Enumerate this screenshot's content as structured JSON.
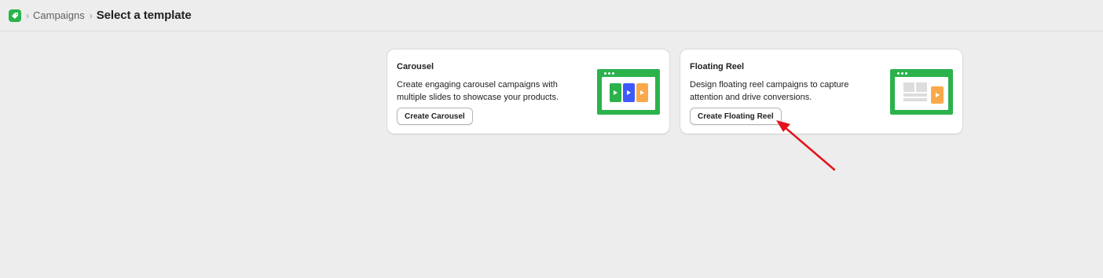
{
  "breadcrumb": {
    "app_icon": "tag-icon",
    "parent": "Campaigns",
    "current": "Select a template"
  },
  "templates": [
    {
      "title": "Carousel",
      "description": "Create engaging carousel campaigns with multiple slides to showcase your products.",
      "button_label": "Create Carousel",
      "illustration": "carousel-illustration"
    },
    {
      "title": "Floating Reel",
      "description": "Design floating reel campaigns to capture attention and drive conversions.",
      "button_label": "Create Floating Reel",
      "illustration": "floating-reel-illustration"
    }
  ],
  "colors": {
    "brand_green": "#2bb24c",
    "slide_blue": "#3d5afe",
    "slide_orange": "#f9a94b",
    "annotation_red": "#e3121a"
  }
}
